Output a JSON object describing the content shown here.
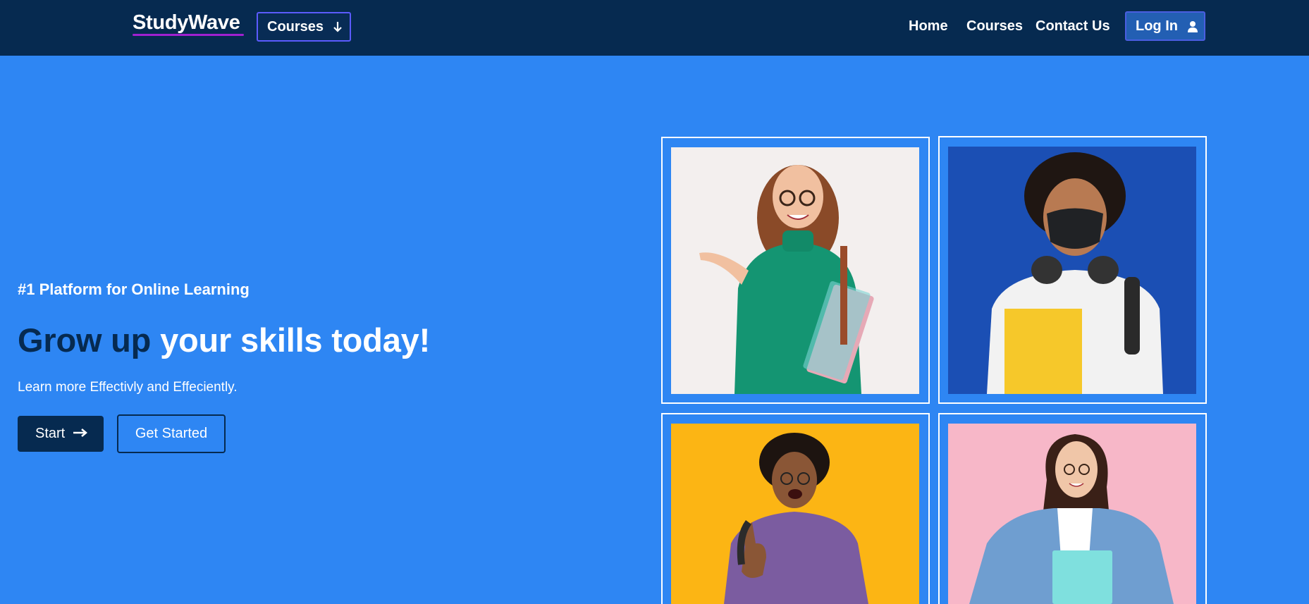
{
  "navbar": {
    "logo": "StudyWave",
    "courses_dropdown": "Courses",
    "links": [
      "Home",
      "Courses",
      "Contact Us"
    ],
    "login": "Log In"
  },
  "hero": {
    "tagline": "#1 Platform for Online Learning",
    "headline_dark": "Grow up",
    "headline_light": "your skills today!",
    "subtitle": "Learn more Effectivly and Effeciently.",
    "start_button": "Start",
    "get_started_button": "Get Started"
  },
  "gallery": {
    "photos": [
      {
        "subject": "student-woman-green-sweater",
        "background": "#f3efee"
      },
      {
        "subject": "student-man-face-mask",
        "background": "#1b4fb4"
      },
      {
        "subject": "student-man-purple-hoodie",
        "background": "#fcb514"
      },
      {
        "subject": "student-woman-denim-jacket",
        "background": "#f7b7c8"
      }
    ]
  },
  "colors": {
    "navbar_bg": "#062a50",
    "hero_bg": "#2e86f3",
    "accent_dark": "#062a50",
    "logo_underline": "#a020d0"
  }
}
